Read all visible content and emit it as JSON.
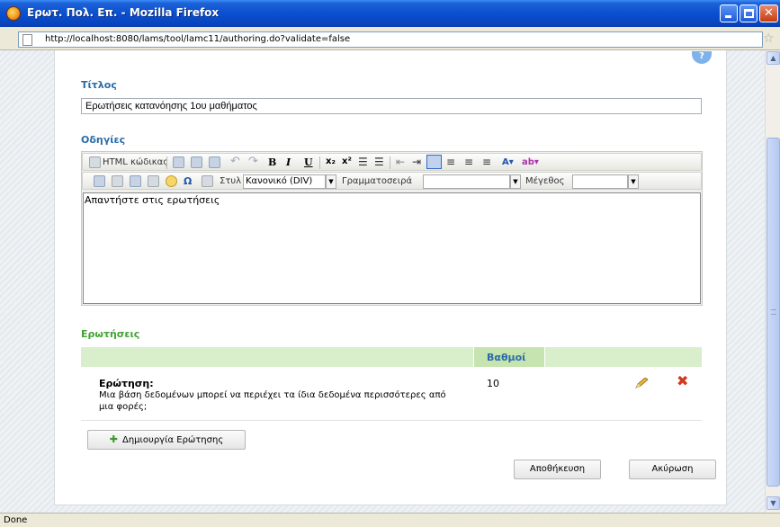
{
  "window": {
    "title": "Ερωτ. Πολ. Επ. - Mozilla Firefox",
    "url": "http://localhost:8080/lams/tool/lamc11/authoring.do?validate=false",
    "status": "Done"
  },
  "form": {
    "help_label": "?",
    "title_label": "Τίτλος",
    "title_value": "Ερωτήσεις κατανόησης 1ου μαθήματος",
    "instructions_label": "Οδηγίες",
    "editor": {
      "html_source_label": "HTML κώδικας",
      "style_label": "Στυλ",
      "style_value": "Κανονικό (DIV)",
      "font_label": "Γραμματοσειρά",
      "font_value": "",
      "size_label": "Μέγεθος",
      "size_value": "",
      "content": "Απαντήστε στις ερωτήσεις"
    },
    "questions_label": "Ερωτήσεις",
    "marks_header": "Βαθμοί",
    "questions": [
      {
        "label": "Ερώτηση:",
        "text": "Μια βάση δεδομένων μπορεί να περιέχει τα ίδια δεδομένα περισσότερες από μια φορές;",
        "marks": "10"
      }
    ],
    "add_question_label": "Δημιουργία Ερώτησης",
    "save_label": "Αποθήκευση",
    "cancel_label": "Ακύρωση"
  },
  "colors": {
    "heading_blue": "#2a6ca8",
    "heading_green": "#43a235",
    "table_header": "#d9eecb"
  }
}
